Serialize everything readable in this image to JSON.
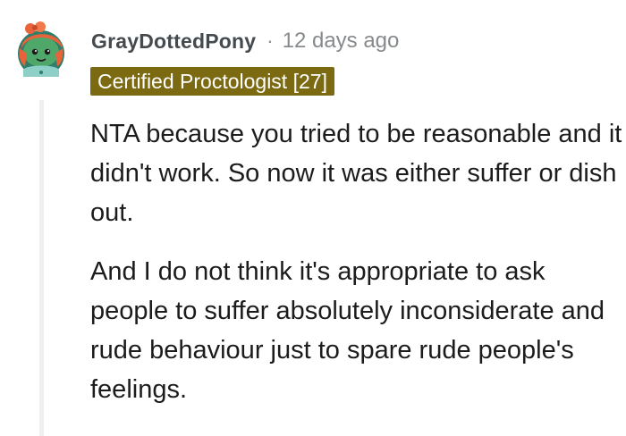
{
  "comment": {
    "author": "GrayDottedPony",
    "separator": "·",
    "timestamp": "12 days ago",
    "flair": "Certified Proctologist [27]",
    "flair_color": "#7c6a12",
    "avatar_icon": "snoo-avatar-icon",
    "paragraphs": [
      "NTA because you tried to be reasonable and it didn't work. So now it was either suffer or dish out.",
      "And I do not think it's appropriate to ask people to suffer absolutely inconsiderate and rude behaviour just to spare rude people's feelings."
    ]
  }
}
